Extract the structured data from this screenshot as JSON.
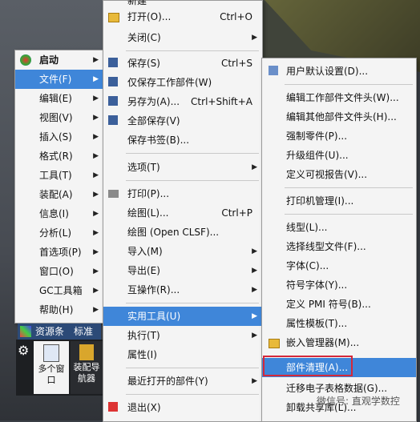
{
  "menu1": {
    "items": [
      {
        "label": "启动",
        "bold": true
      },
      {
        "label": "文件(F)",
        "highlight": true
      },
      {
        "label": "编辑(E)"
      },
      {
        "label": "视图(V)"
      },
      {
        "label": "插入(S)"
      },
      {
        "label": "格式(R)"
      },
      {
        "label": "工具(T)"
      },
      {
        "label": "装配(A)"
      },
      {
        "label": "信息(I)"
      },
      {
        "label": "分析(L)"
      },
      {
        "label": "首选项(P)"
      },
      {
        "label": "窗口(O)"
      },
      {
        "label": "GC工具箱"
      },
      {
        "label": "帮助(H)"
      }
    ]
  },
  "menu2": {
    "top_partial": "新建",
    "items": [
      {
        "label": "打开(O)...",
        "shortcut": "Ctrl+O",
        "icon": "folder-open-icon"
      },
      {
        "label": "关闭(C)",
        "arrow": true
      },
      {
        "label": "保存(S)",
        "shortcut": "Ctrl+S",
        "icon": "save-icon"
      },
      {
        "label": "仅保存工作部件(W)",
        "icon": "save-work-icon"
      },
      {
        "label": "另存为(A)...",
        "shortcut": "Ctrl+Shift+A",
        "icon": "save-as-icon"
      },
      {
        "label": "全部保存(V)",
        "icon": "save-all-icon"
      },
      {
        "label": "保存书签(B)..."
      },
      {
        "label": "选项(T)",
        "arrow": true
      },
      {
        "label": "打印(P)...",
        "icon": "print-icon"
      },
      {
        "label": "绘图(L)...",
        "shortcut": "Ctrl+P"
      },
      {
        "label": "绘图 (Open CLSF)..."
      },
      {
        "label": "导入(M)",
        "arrow": true
      },
      {
        "label": "导出(E)",
        "arrow": true
      },
      {
        "label": "互操作(R)...",
        "arrow": true
      },
      {
        "label": "实用工具(U)",
        "arrow": true,
        "highlight": true
      },
      {
        "label": "执行(T)",
        "arrow": true
      },
      {
        "label": "属性(I)"
      },
      {
        "label": "最近打开的部件(Y)",
        "arrow": true
      },
      {
        "label": "退出(X)",
        "icon": "exit-icon"
      }
    ]
  },
  "menu3": {
    "items": [
      {
        "label": "用户默认设置(D)...",
        "icon": "settings-icon"
      },
      {
        "label": "编辑工作部件文件头(W)..."
      },
      {
        "label": "编辑其他部件文件头(H)..."
      },
      {
        "label": "强制零件(P)..."
      },
      {
        "label": "升级组件(U)..."
      },
      {
        "label": "定义可视报告(V)..."
      },
      {
        "label": "打印机管理(I)..."
      },
      {
        "label": "线型(L)..."
      },
      {
        "label": "选择线型文件(F)..."
      },
      {
        "label": "字体(C)..."
      },
      {
        "label": "符号字体(Y)..."
      },
      {
        "label": "定义 PMI 符号(B)..."
      },
      {
        "label": "属性模板(T)..."
      },
      {
        "label": "嵌入管理器(M)...",
        "icon": "folder-icon"
      },
      {
        "label": "部件清理(A)...",
        "highlight": true
      },
      {
        "label": "迁移电子表格数据(G)..."
      },
      {
        "label": "卸载共享库(L)..."
      }
    ]
  },
  "panel": {
    "tabs": [
      "资源条",
      "标准"
    ],
    "buttons": [
      "多个窗口",
      "装配导航器"
    ]
  },
  "watermark": "微信号: 直观学数控",
  "colors": {
    "highlight": "#3f86d9",
    "redbox": "#d4283a"
  }
}
